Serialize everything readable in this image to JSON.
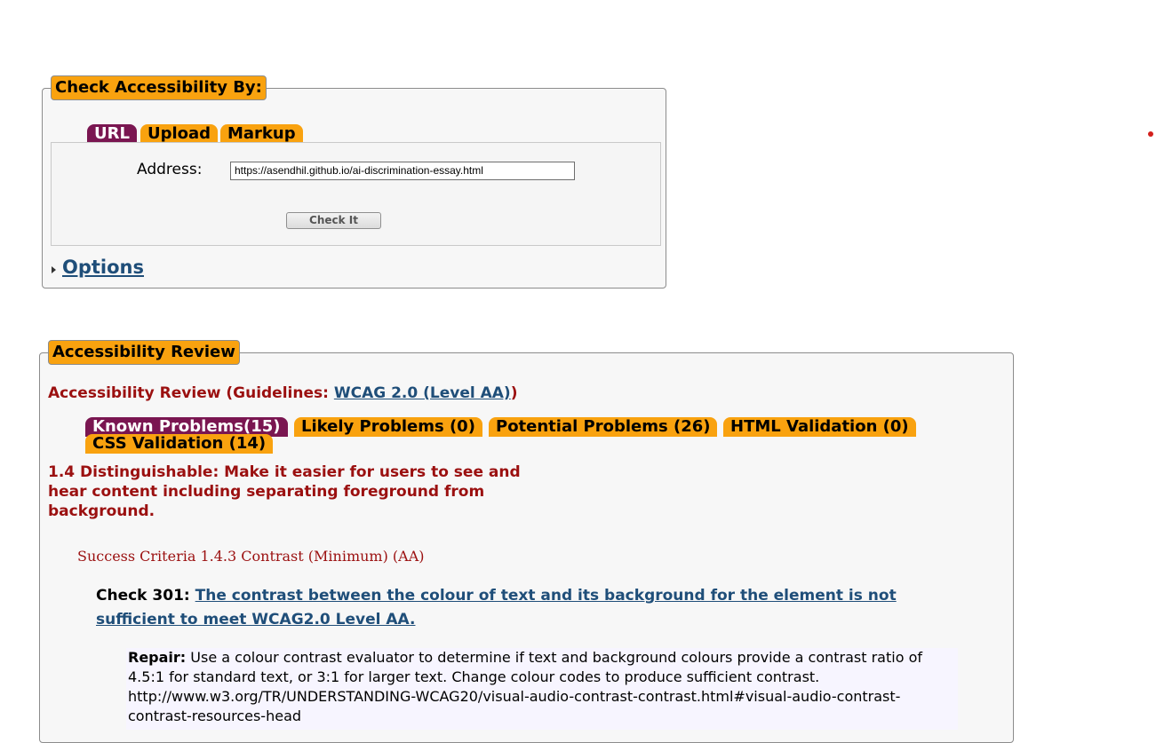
{
  "check_panel": {
    "legend": "Check Accessibility By:",
    "tabs": [
      {
        "label": "URL",
        "active": true
      },
      {
        "label": "Upload",
        "active": false
      },
      {
        "label": "Markup",
        "active": false
      }
    ],
    "address_label": "Address:",
    "address_value": "https://asendhil.github.io/ai-discrimination-essay.html",
    "check_button": "Check It",
    "options_link": "Options"
  },
  "review_panel": {
    "legend": "Accessibility Review",
    "title_prefix": "Accessibility Review (Guidelines: ",
    "title_link": "WCAG 2.0 (Level AA)",
    "title_suffix": ")",
    "tabs": [
      {
        "label": "Known Problems(15)",
        "active": true
      },
      {
        "label": "Likely Problems (0)",
        "active": false
      },
      {
        "label": "Potential Problems (26)",
        "active": false
      },
      {
        "label": "HTML Validation (0)",
        "active": false
      },
      {
        "label": "CSS Validation (14)",
        "active": false
      }
    ],
    "guideline": "1.4 Distinguishable: Make it easier for users to see and hear content including separating foreground from background.",
    "criteria": "Success Criteria 1.4.3 Contrast (Minimum) (AA)",
    "check_prefix": "Check 301: ",
    "check_link": "The contrast between the colour of text and its background for the element is not sufficient to meet WCAG2.0 Level AA.",
    "repair_label": "Repair:",
    "repair_text": " Use a colour contrast evaluator to determine if text and background colours provide a contrast ratio of 4.5:1 for standard text, or 3:1 for larger text. Change colour codes to produce sufficient contrast. http://www.w3.org/TR/UNDERSTANDING-WCAG20/visual-audio-contrast-contrast.html#visual-audio-contrast-contrast-resources-head"
  },
  "colors": {
    "tab_orange": "#f9a20f",
    "tab_active": "#7a1651",
    "heading_red": "#9b1010",
    "link_blue": "#1f4e79"
  }
}
